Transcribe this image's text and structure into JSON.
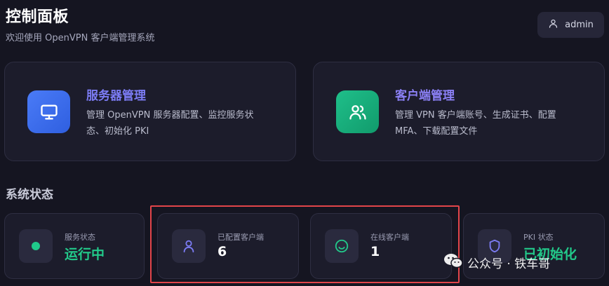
{
  "header": {
    "title": "控制面板",
    "subtitle": "欢迎使用 OpenVPN 客户端管理系统",
    "user": {
      "name": "admin",
      "icon": "user-icon"
    }
  },
  "cards": [
    {
      "title": "服务器管理",
      "desc": "管理 OpenVPN 服务器配置、监控服务状态、初始化 PKI",
      "icon": "monitor-icon",
      "color": "#3d6df0"
    },
    {
      "title": "客户端管理",
      "desc": "管理 VPN 客户端账号、生成证书、配置 MFA、下载配置文件",
      "icon": "users-icon",
      "color": "#17b07c"
    }
  ],
  "status_section": {
    "title": "系统状态",
    "items": [
      {
        "label": "服务状态",
        "value": "运行中",
        "icon": "status-dot-icon",
        "value_color": "#22c98a"
      },
      {
        "label": "已配置客户端",
        "value": "6",
        "icon": "user-icon"
      },
      {
        "label": "在线客户端",
        "value": "1",
        "icon": "smile-icon"
      },
      {
        "label": "PKI 状态",
        "value": "已初始化",
        "icon": "shield-icon",
        "value_color": "#22c98a"
      }
    ]
  },
  "watermark": {
    "text": "公众号 · 铁车哥",
    "icon": "wechat-icon"
  }
}
